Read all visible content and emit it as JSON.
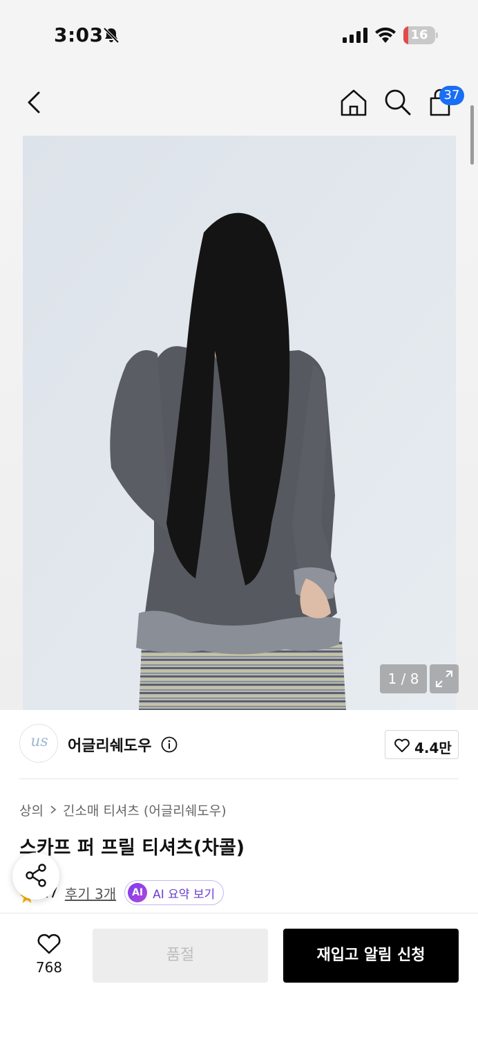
{
  "status_bar": {
    "time": "3:03",
    "battery_level": "16",
    "battery_fraction": 0.16,
    "icons": [
      "bell-off-icon",
      "signal-icon",
      "wifi-icon",
      "battery-icon"
    ]
  },
  "header": {
    "icons": [
      "back-icon",
      "home-icon",
      "search-icon",
      "cart-icon"
    ],
    "cart_count": "37"
  },
  "gallery": {
    "page_indicator": "1 / 8",
    "icons": [
      "expand-icon"
    ]
  },
  "brand": {
    "logo_text": "us",
    "name": "어글리쉐도우",
    "like_count": "4.4만",
    "icons": [
      "info-icon",
      "heart-icon"
    ]
  },
  "breadcrumb": {
    "category": "상의",
    "subcategory": "긴소매 티셔츠 (어글리쉐도우)"
  },
  "product": {
    "title": "스카프 퍼 프릴 티셔츠(차콜)",
    "rating": "4.7",
    "review_link": "후기 3개",
    "ai_badge": "AI",
    "ai_summary_label": "AI 요약 보기"
  },
  "bottom_bar": {
    "wish_count": "768",
    "soldout_label": "품절",
    "restock_label": "재입고 알림 신청",
    "icons": [
      "heart-icon",
      "share-icon"
    ]
  },
  "colors": {
    "accent_blue": "#1a6ef5",
    "ai_purple": "#7a3ff0",
    "cta_black": "#000000",
    "battery_red": "#e24b4b"
  }
}
